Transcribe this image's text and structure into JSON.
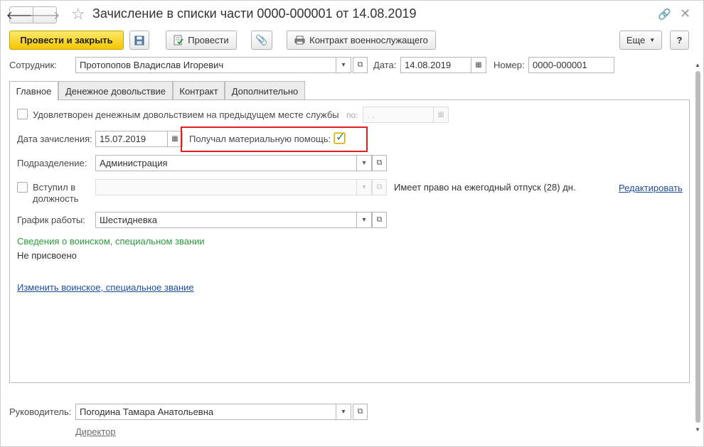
{
  "window": {
    "title": "Зачисление в списки части 0000-000001 от 14.08.2019"
  },
  "icons": {
    "back": "arrow-left-icon",
    "forward": "arrow-right-icon",
    "favorite": "star-icon",
    "link": "link-icon",
    "close": "close-icon"
  },
  "toolbar": {
    "post_and_close": "Провести и закрыть",
    "post": "Провести",
    "contract": "Контракт военнослужащего",
    "more": "Еще",
    "help": "?"
  },
  "header_fields": {
    "employee_label": "Сотрудник:",
    "employee_value": "Протопопов Владислав Игоревич",
    "date_label": "Дата:",
    "date_value": "14.08.2019",
    "number_label": "Номер:",
    "number_value": "0000-000001"
  },
  "tabs": [
    {
      "label": "Главное",
      "active": true
    },
    {
      "label": "Денежное довольствие",
      "active": false
    },
    {
      "label": "Контракт",
      "active": false
    },
    {
      "label": "Дополнительно",
      "active": false
    }
  ],
  "main": {
    "satisfied_label": "Удовлетворен денежным довольствием на предыдущем месте службы",
    "satisfied_checked": false,
    "po_label": "по:",
    "po_value": " .  .",
    "enroll_date_label": "Дата зачисления:",
    "enroll_date_value": "15.07.2019",
    "material_aid_label": "Получал материальную помощь:",
    "material_aid_checked": true,
    "division_label": "Подразделение:",
    "division_value": "Администрация",
    "position_label": "Вступил в должность",
    "position_checked": false,
    "position_value": "",
    "vacation_text": "Имеет право на ежегодный отпуск (28) дн.",
    "edit_link": "Редактировать",
    "schedule_label": "График работы:",
    "schedule_value": "Шестидневка",
    "military_section_title": "Сведения о воинском, специальном звании",
    "military_rank": "Не присвоено",
    "change_rank_link": "Изменить воинское, специальное звание"
  },
  "footer": {
    "head_label": "Руководитель:",
    "head_value": "Погодина Тамара Анатольевна",
    "head_position": "Директор"
  },
  "colors": {
    "primary_button": "#f5c700",
    "highlight": "#e21e1e",
    "link": "#1f4e9c",
    "section_title": "#2a9a3c",
    "check": "#2e8b3d"
  }
}
